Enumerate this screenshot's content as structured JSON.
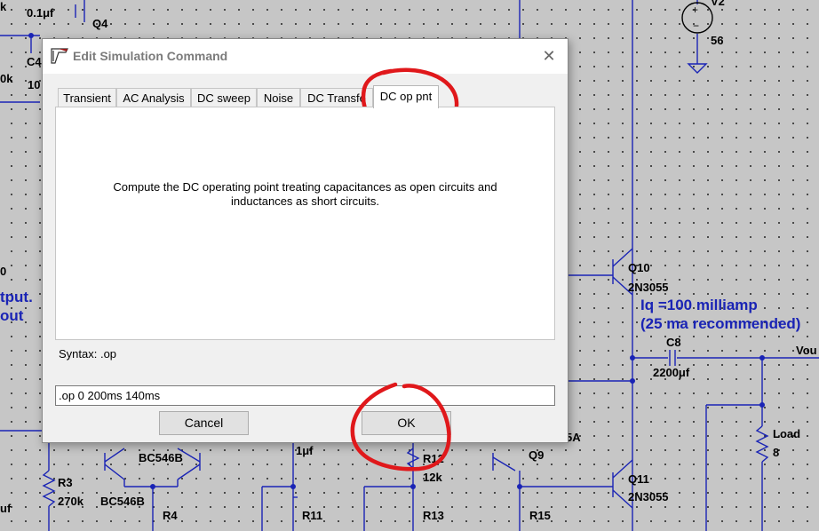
{
  "dialog": {
    "title": "Edit Simulation Command",
    "tabs": [
      {
        "label": "Transient"
      },
      {
        "label": "AC Analysis"
      },
      {
        "label": "DC sweep"
      },
      {
        "label": "Noise"
      },
      {
        "label": "DC Transfe"
      },
      {
        "label": "DC op pnt",
        "active": true
      }
    ],
    "description_line1": "Compute the DC operating point treating capacitances as open circuits and",
    "description_line2": "inductances as short circuits.",
    "syntax": "Syntax: .op",
    "command_value": ".op 0 200ms 140ms",
    "cancel_label": "Cancel",
    "ok_label": "OK"
  },
  "schematic": {
    "labels": {
      "k_top": "k",
      "c_0_1pf": "0.1μf",
      "q4": "Q4",
      "c4": "C4",
      "ok_left": "0k",
      "ten": "10",
      "v2": "V2",
      "v2_value": "56",
      "zero_left": "0",
      "output_partial": "tput.",
      "out_partial": "out",
      "q10": "Q10",
      "q10_model": "2N3055",
      "iq_note": "Iq =100 milliamp",
      "iq_recommended": "(25 ma recommended)",
      "c8": "C8",
      "c8_value": "2200μf",
      "vout_partial": "Vou",
      "load": "Load",
      "load_value": "8",
      "r3": "R3",
      "r3_value": "270k",
      "bc546b_1": "BC546B",
      "bc546b_2": "BC546B",
      "r4": "R4",
      "one_uf": "1μf",
      "r11": "R11",
      "r12": "R12",
      "r12_value": "12k",
      "r13": "R13",
      "q9": "Q9",
      "five_a": "5A",
      "q11": "Q11",
      "q11_model": "2N3055",
      "r15": "R15",
      "uf_left": "uf"
    }
  },
  "colors": {
    "wire": "#1a24b5",
    "annotation": "#e0181b",
    "schematic_bg": "#c6c6c6"
  }
}
